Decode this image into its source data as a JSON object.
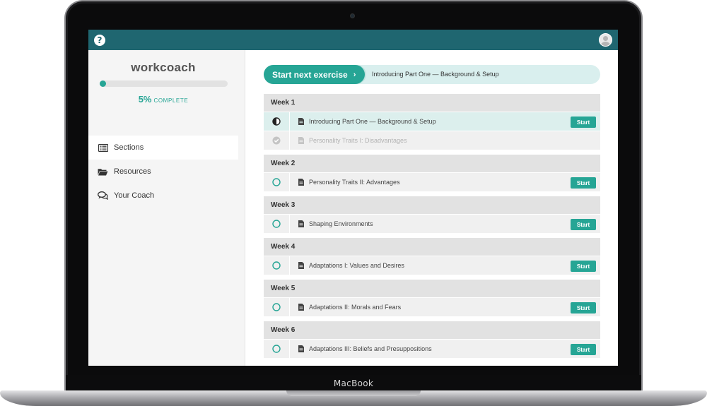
{
  "device": {
    "label": "MacBook"
  },
  "app": {
    "brand": "workcoach",
    "progress": {
      "percent": 5,
      "percent_label": "5%",
      "complete_label": "COMPLETE"
    },
    "nav": [
      {
        "label": "Sections",
        "icon": "list-icon",
        "active": true
      },
      {
        "label": "Resources",
        "icon": "folder-icon",
        "active": false
      },
      {
        "label": "Your Coach",
        "icon": "chat-icon",
        "active": false
      }
    ],
    "next_exercise": {
      "button_label": "Start next exercise",
      "chevron": "›",
      "title": "Introducing Part One — Background & Setup"
    },
    "start_label": "Start",
    "weeks": [
      {
        "label": "Week 1",
        "items": [
          {
            "title": "Introducing Part One — Background & Setup",
            "status": "in-progress"
          },
          {
            "title": "Personality Traits I: Disadvantages",
            "status": "completed"
          }
        ]
      },
      {
        "label": "Week 2",
        "items": [
          {
            "title": "Personality Traits II: Advantages",
            "status": "not-started"
          }
        ]
      },
      {
        "label": "Week 3",
        "items": [
          {
            "title": "Shaping Environments",
            "status": "not-started"
          }
        ]
      },
      {
        "label": "Week 4",
        "items": [
          {
            "title": "Adaptations I: Values and Desires",
            "status": "not-started"
          }
        ]
      },
      {
        "label": "Week 5",
        "items": [
          {
            "title": "Adaptations II: Morals and Fears",
            "status": "not-started"
          }
        ]
      },
      {
        "label": "Week 6",
        "items": [
          {
            "title": "Adaptations III: Beliefs and Presuppositions",
            "status": "not-started"
          }
        ]
      }
    ],
    "colors": {
      "header": "#1f6670",
      "accent": "#26a595",
      "highlight": "#dcefed"
    }
  }
}
